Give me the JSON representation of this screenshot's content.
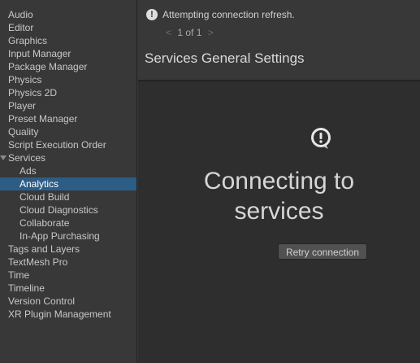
{
  "sidebar": {
    "items": [
      {
        "label": "Audio"
      },
      {
        "label": "Editor"
      },
      {
        "label": "Graphics"
      },
      {
        "label": "Input Manager"
      },
      {
        "label": "Package Manager"
      },
      {
        "label": "Physics"
      },
      {
        "label": "Physics 2D"
      },
      {
        "label": "Player"
      },
      {
        "label": "Preset Manager"
      },
      {
        "label": "Quality"
      },
      {
        "label": "Script Execution Order"
      },
      {
        "label": "Services"
      },
      {
        "label": "Ads"
      },
      {
        "label": "Analytics"
      },
      {
        "label": "Cloud Build"
      },
      {
        "label": "Cloud Diagnostics"
      },
      {
        "label": "Collaborate"
      },
      {
        "label": "In-App Purchasing"
      },
      {
        "label": "Tags and Layers"
      },
      {
        "label": "TextMesh Pro"
      },
      {
        "label": "Time"
      },
      {
        "label": "Timeline"
      },
      {
        "label": "Version Control"
      },
      {
        "label": "XR Plugin Management"
      }
    ]
  },
  "notification": {
    "icon": "info-icon",
    "text": "Attempting connection refresh.",
    "pager": {
      "prev": "<",
      "label": "1 of 1",
      "next": ">"
    }
  },
  "header": {
    "title": "Services General Settings"
  },
  "main": {
    "icon": "warning-bubble-icon",
    "status_line1": "Connecting to",
    "status_line2": "services",
    "retry_label": "Retry connection"
  },
  "colors": {
    "selected": "#2c5d87",
    "background": "#383838",
    "panel": "#2e2e2e"
  }
}
